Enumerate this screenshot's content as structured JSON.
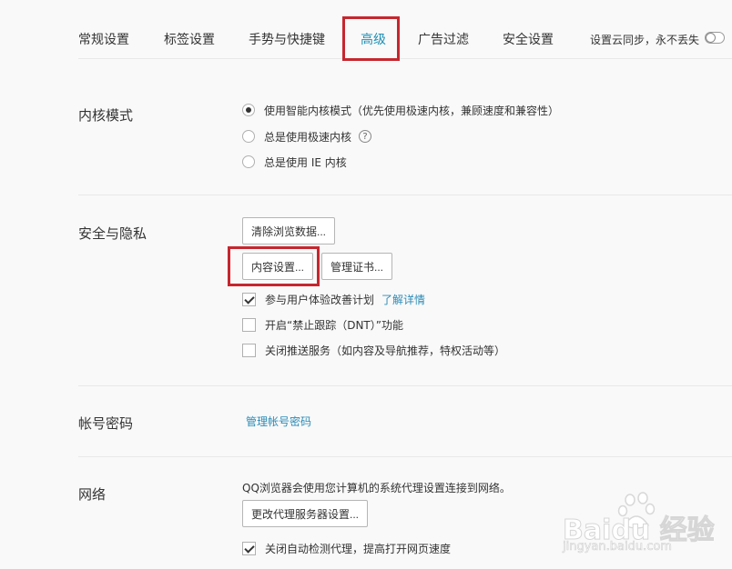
{
  "tabs": [
    {
      "label": "常规设置",
      "active": false
    },
    {
      "label": "标签设置",
      "active": false
    },
    {
      "label": "手势与快捷键",
      "active": false
    },
    {
      "label": "高级",
      "active": true
    },
    {
      "label": "广告过滤",
      "active": false
    },
    {
      "label": "安全设置",
      "active": false
    }
  ],
  "sync": {
    "label": "设置云同步，永不丢失",
    "enabled": false
  },
  "kernel": {
    "title": "内核模式",
    "options": [
      {
        "label": "使用智能内核模式（优先使用极速内核，兼顾速度和兼容性）",
        "checked": true
      },
      {
        "label": "总是使用极速内核",
        "checked": false,
        "help": "?"
      },
      {
        "label": "总是使用 IE 内核",
        "checked": false
      }
    ]
  },
  "privacy": {
    "title": "安全与隐私",
    "clear_button": "清除浏览数据...",
    "content_button": "内容设置...",
    "cert_button": "管理证书...",
    "checks": [
      {
        "label": "参与用户体验改善计划",
        "checked": true,
        "link": "了解详情"
      },
      {
        "label": "开启“禁止跟踪（DNT）”功能",
        "checked": false
      },
      {
        "label": "关闭推送服务（如内容及导航推荐，特权活动等）",
        "checked": false
      }
    ]
  },
  "account": {
    "title": "帐号密码",
    "link": "管理帐号密码"
  },
  "network": {
    "title": "网络",
    "description": "QQ浏览器会使用您计算机的系统代理设置连接到网络。",
    "proxy_button": "更改代理服务器设置...",
    "auto_detect": {
      "label": "关闭自动检测代理，提高打开网页速度",
      "checked": true
    }
  },
  "watermark": {
    "text": "Baidu 经验",
    "url": "jingyan.baidu.com"
  },
  "colors": {
    "accent": "#1e8fb5",
    "highlight": "#c6262e",
    "link": "#2a8bb7"
  }
}
